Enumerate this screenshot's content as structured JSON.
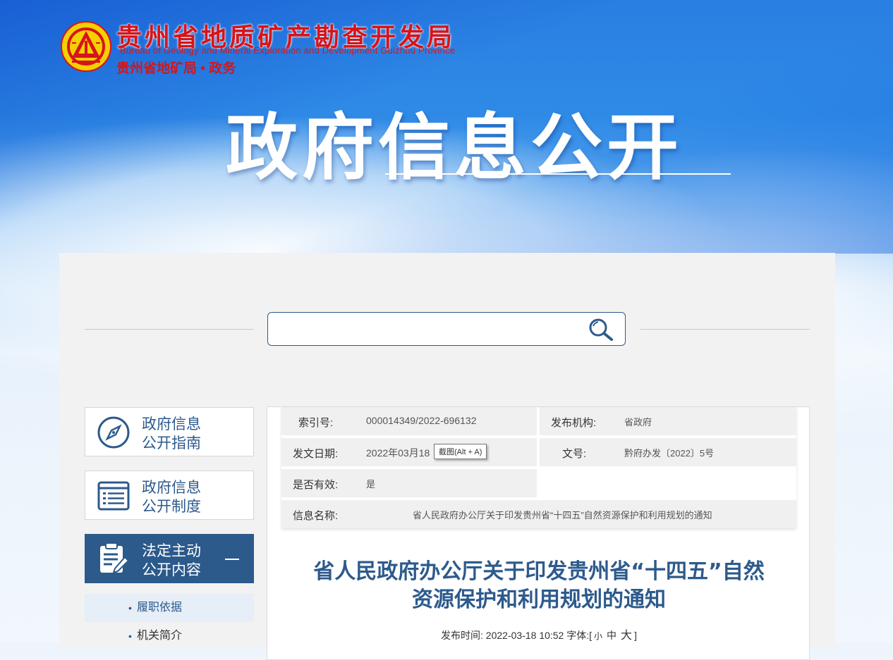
{
  "header": {
    "org_name_cn": "贵州省地质矿产勘查开发局",
    "org_name_en": "Bureau of Geology and Mineral Exploration and Development Guizhou Province",
    "sub_title": "贵州省地矿局 • 政务",
    "banner_title": "政府信息公开",
    "colors": {
      "brand_red": "#d7141a",
      "banner_blue": "#2a7fe2"
    }
  },
  "search": {
    "placeholder": "",
    "value": "",
    "icon": "search-icon"
  },
  "sidebar": {
    "items": [
      {
        "line1": "政府信息",
        "line2": "公开指南",
        "icon": "compass-icon"
      },
      {
        "line1": "政府信息",
        "line2": "公开制度",
        "icon": "list-icon"
      },
      {
        "line1": "法定主动",
        "line2": "公开内容",
        "icon": "clipboard-edit-icon",
        "active": true
      }
    ],
    "sub_items": [
      {
        "label": "履职依据",
        "current": true
      },
      {
        "label": "机关简介"
      }
    ],
    "accent_color": "#2b5a8b"
  },
  "meta": {
    "index_label": "索引号:",
    "index_value": "000014349/2022-696132",
    "publisher_label": "发布机构:",
    "publisher_value": "省政府",
    "date_label": "发文日期:",
    "date_value": "2022年03月18",
    "doc_no_label": "文号:",
    "doc_no_value": "黔府办发〔2022〕5号",
    "valid_label": "是否有效:",
    "valid_value": "是",
    "name_label": "信息名称:",
    "name_value": "省人民政府办公厅关于印发贵州省“十四五”自然资源保护和利用规划的通知",
    "tooltip": "截图(Alt + A)"
  },
  "article": {
    "title_line1": "省人民政府办公厅关于印发贵州省“十四五”自然",
    "title_line2": "资源保护和利用规划的通知",
    "publish_prefix": "发布时间: 2022-03-18 10:52 字体:[",
    "font_small": "小",
    "font_medium": "中",
    "font_large": "大",
    "publish_suffix": "]"
  }
}
